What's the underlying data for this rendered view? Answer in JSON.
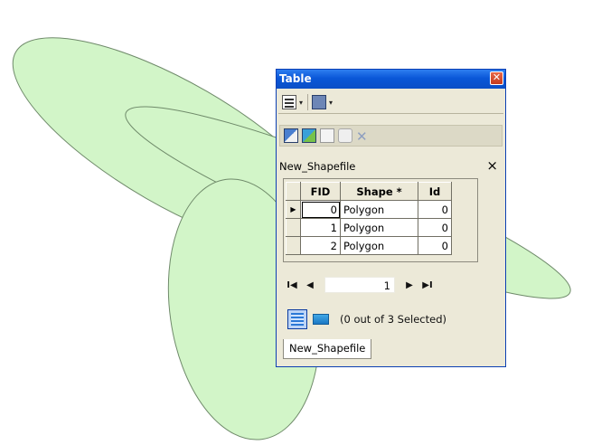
{
  "window": {
    "title": "Table",
    "close_glyph": "✕"
  },
  "icons": {
    "table_options": "table-options-icon",
    "related_tables": "related-tables-icon",
    "select_by_attributes": "select-by-attributes-icon",
    "switch_selection": "switch-selection-icon",
    "clear_selection": "clear-selection-icon",
    "zoom_to_selected": "zoom-to-selected-icon",
    "delete_selected": "delete-selected-icon"
  },
  "toolbar": {
    "dropdown_glyph": "▾",
    "delete_glyph": "✕"
  },
  "table_tab": {
    "title": "New_Shapefile",
    "close_glyph": "×"
  },
  "grid": {
    "headers": [
      "FID",
      "Shape *",
      "Id"
    ],
    "rows": [
      {
        "indicator": "▶",
        "fid": "0",
        "shape": "Polygon",
        "id": "0"
      },
      {
        "indicator": "",
        "fid": "1",
        "shape": "Polygon",
        "id": "0"
      },
      {
        "indicator": "",
        "fid": "2",
        "shape": "Polygon",
        "id": "0"
      }
    ]
  },
  "navigation": {
    "first": "I◀",
    "prev": "◀",
    "current_record": "1",
    "next": "▶",
    "last": "▶I"
  },
  "status": {
    "selection_text": "(0 out of 3 Selected)"
  },
  "bottom_tab": {
    "label": "New_Shapefile"
  },
  "colors": {
    "polygon_fill": "#d2f5c8",
    "polygon_stroke": "#6f8a6a",
    "title_bar": "#0a57d8",
    "window_face": "#ece9d8"
  }
}
